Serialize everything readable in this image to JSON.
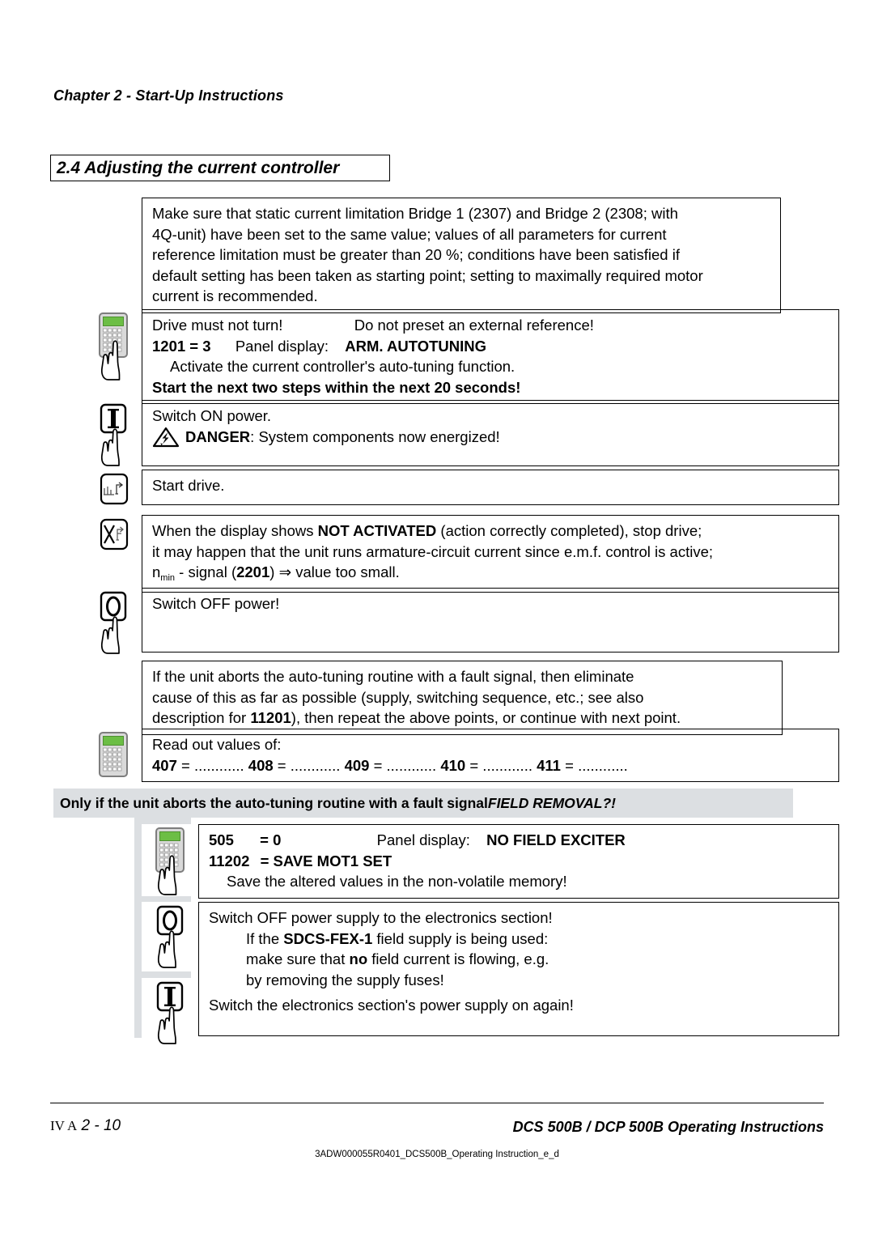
{
  "header": {
    "chapter": "Chapter 2 - Start-Up Instructions"
  },
  "section": {
    "title": "2.4 Adjusting the current controller"
  },
  "steps": [
    {
      "id": "intro",
      "icon": "none",
      "lines": [
        "Make sure that static current limitation Bridge 1 (2307) and Bridge 2 (2308; with",
        "4Q-unit) have been set to the same value; values of all parameters for current",
        "reference limitation must be greater than 20 %; conditions have been satisfied if",
        "default setting has been taken as starting point; setting to maximally required motor",
        "current is recommended."
      ]
    },
    {
      "id": "autotuning",
      "icon": "keypad-panel-icon",
      "line_drive": "Drive must not turn!",
      "line_noref": "Do not preset an external reference!",
      "param": "1201 = 3",
      "panel_label": "Panel display:",
      "panel_value": "ARM. AUTOTUNING",
      "activate": "Activate the current controller's auto-tuning function.",
      "warn": "Start the next two steps within the next 20 seconds!"
    },
    {
      "id": "switch-on",
      "icon": "power-on-icon",
      "line1": "Switch ON power.",
      "danger_word": "DANGER",
      "danger_rest": ": System components now energized!"
    },
    {
      "id": "start-drive",
      "icon": "start-drive-icon",
      "line1": "Start drive."
    },
    {
      "id": "not-activated",
      "icon": "stop-drive-icon",
      "l1a": "When the display shows ",
      "l1b": "NOT ACTIVATED",
      "l1c": " (action correctly completed), stop drive;",
      "l2": "it may happen that the unit runs armature-circuit current since e.m.f. control is active;",
      "l3a": "n",
      "l3sub": "min",
      "l3b": " - signal (",
      "l3param": "2201",
      "l3c": ") ⇒ value too small."
    },
    {
      "id": "switch-off",
      "icon": "power-off-icon",
      "line1": "Switch OFF power!"
    },
    {
      "id": "fault-note",
      "icon": "none",
      "l1": "If the unit aborts the auto-tuning routine with a fault signal, then eliminate",
      "l2": "cause of this as far as possible (supply, switching sequence, etc.; see also",
      "l3a": "description for ",
      "l3param": "11201",
      "l3b": "), then repeat the above points, or continue with next point."
    },
    {
      "id": "readout",
      "icon": "keypad-readout-icon",
      "line1": "Read out values of:",
      "values": [
        {
          "id": "407",
          "eq": "= ............"
        },
        {
          "id": "408",
          "eq": "= ............"
        },
        {
          "id": "409",
          "eq": "= ............"
        },
        {
          "id": "410",
          "eq": "= ............"
        },
        {
          "id": "411",
          "eq": "= ............"
        }
      ]
    }
  ],
  "conditional": {
    "banner_text": "Only if the unit aborts the auto-tuning routine with a fault signal ",
    "banner_italic": "FIELD REMOVAL?!",
    "steps": [
      {
        "id": "no-field-exciter",
        "icon": "keypad-panel-icon",
        "param1": "505",
        "param1_val": "= 0",
        "panel_label": "Panel display:",
        "panel_value": "NO FIELD EXCITER",
        "param2": "11202",
        "param2_val": "= SAVE MOT1 SET",
        "save_note": "Save the altered values in the non-volatile memory!"
      },
      {
        "id": "electronics-off-on",
        "icon_off": "power-off-icon",
        "icon_on": "power-on-icon",
        "l1": "Switch OFF power supply to the electronics section!",
        "l2a": "If the ",
        "l2b": "SDCS-FEX-1",
        "l2c": " field supply is being used:",
        "l3a": "make sure that ",
        "l3b": "no",
        "l3c": " field current is flowing, e.g.",
        "l4": "by removing the supply fuses!",
        "l5": "Switch the electronics section's power supply on again!"
      }
    ]
  },
  "footer": {
    "left_prefix": "IV A",
    "left_page": "2 - 10",
    "right": "DCS 500B / DCP 500B Operating Instructions",
    "doc_code": "3ADW000055R0401_DCS500B_Operating Instruction_e_d"
  },
  "colors": {
    "lcd_green": "#6cbe45",
    "banner_grey": "#dcdfe2",
    "panel_body": "#d9d9d9",
    "panel_outline": "#808080"
  }
}
